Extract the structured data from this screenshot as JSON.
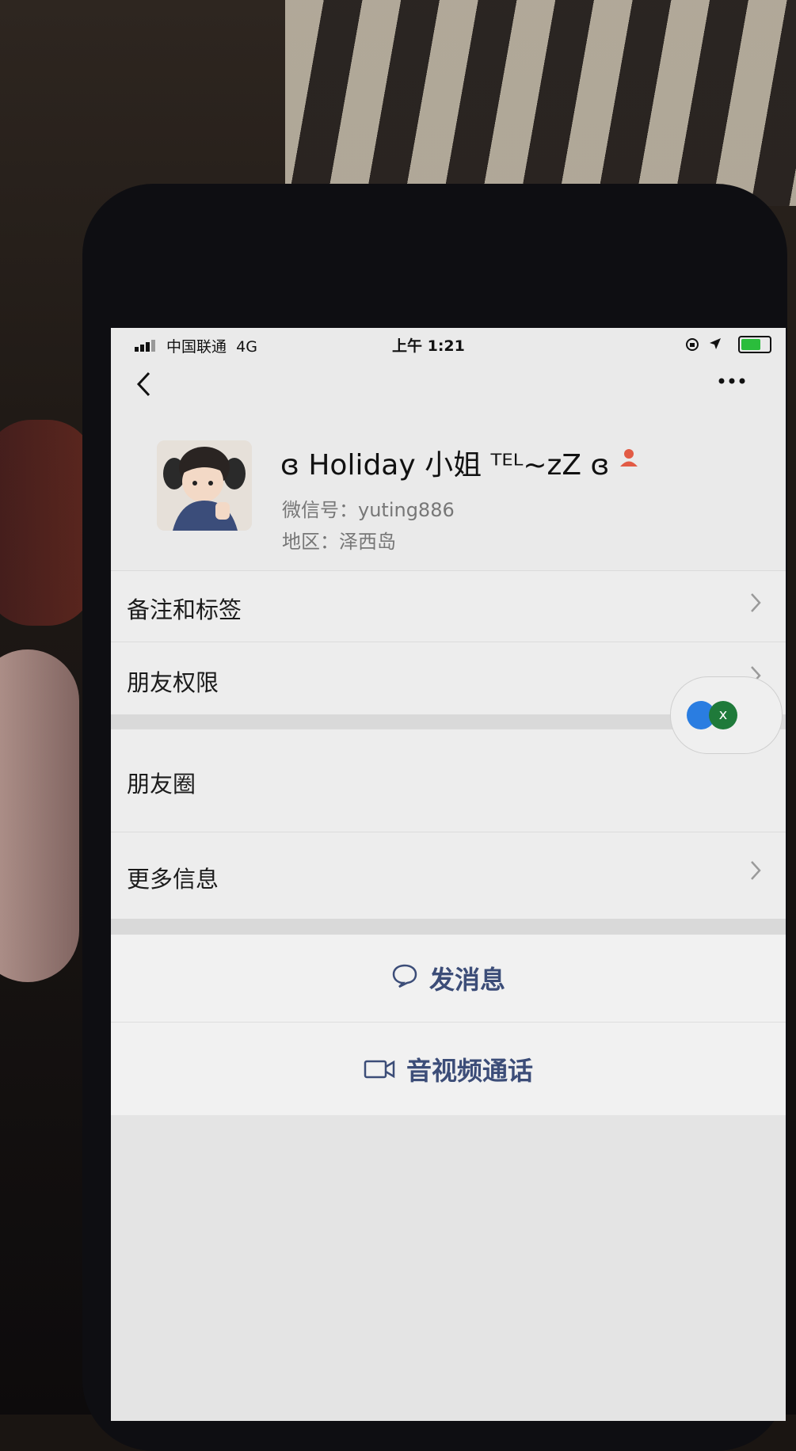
{
  "status_bar": {
    "carrier": "中国联通",
    "network": "4G",
    "time": "上午 1:21"
  },
  "profile": {
    "nickname": "ɞ Holiday 小姐 ᵀᴱᴸ~zZ ɞ",
    "wechat_id": "微信号：yuting886",
    "region": "地区：泽西岛"
  },
  "menu": {
    "remarks_tags": "备注和标签",
    "friend_permissions": "朋友权限",
    "moments": "朋友圈",
    "more_info": "更多信息"
  },
  "actions": {
    "send_message": "发消息",
    "video_call": "音视频通话"
  },
  "floating": {
    "badge_letter": "x"
  },
  "colors": {
    "action_text": "#3c4d78",
    "battery": "#2bbd3c",
    "badge": "#e25b45"
  },
  "icons": [
    "back-icon",
    "more-icon",
    "chat-bubble-icon",
    "video-camera-icon",
    "chevron-right-icon",
    "person-badge-icon"
  ]
}
